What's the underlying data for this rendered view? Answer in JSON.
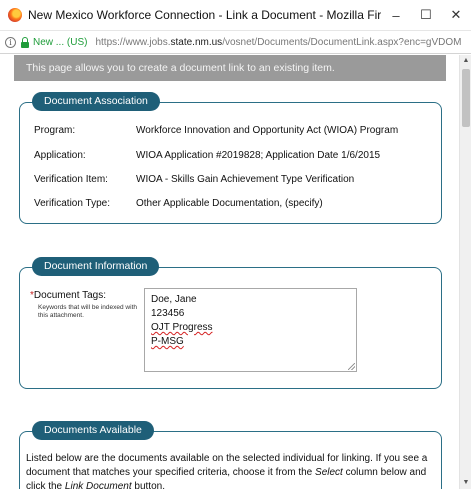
{
  "window": {
    "title": "New Mexico Workforce Connection - Link a Document - Mozilla Firefox",
    "minimize": "–",
    "maximize": "☐",
    "close": "✕"
  },
  "urlbar": {
    "info": "i",
    "site_id": "New ... (US)",
    "url_prefix": "https://www.jobs.",
    "url_domain": "state.nm.us",
    "url_suffix": "/vosnet/Documents/DocumentLink.aspx?enc=gVDOM"
  },
  "banner": "This page allows you to create a document link to an existing item.",
  "association": {
    "legend": "Document Association",
    "rows": [
      {
        "label": "Program:",
        "value": "Workforce Innovation and Opportunity Act (WIOA) Program"
      },
      {
        "label": "Application:",
        "value": "WIOA Application #2019828; Application Date 1/6/2015"
      },
      {
        "label": "Verification Item:",
        "value": "WIOA - Skills Gain Achievement Type Verification"
      },
      {
        "label": "Verification Type:",
        "value": "Other Applicable Documentation, (specify)"
      }
    ]
  },
  "information": {
    "legend": "Document Information",
    "required_mark": "*",
    "tags_label": "Document Tags:",
    "tags_hint": "Keywords that will be indexed with this attachment.",
    "tags_lines": [
      "Doe, Jane",
      "123456",
      "OJT Progress",
      "P-MSG"
    ]
  },
  "available": {
    "legend": "Documents Available",
    "text_1": "Listed below are the documents available on the selected individual for linking. If you see a document that matches your specified criteria, choose it from the ",
    "text_select": "Select",
    "text_2": " column below and click the ",
    "text_link": "Link Document",
    "text_3": " button."
  },
  "scrollbar": {
    "up": "▲",
    "down": "▼"
  }
}
